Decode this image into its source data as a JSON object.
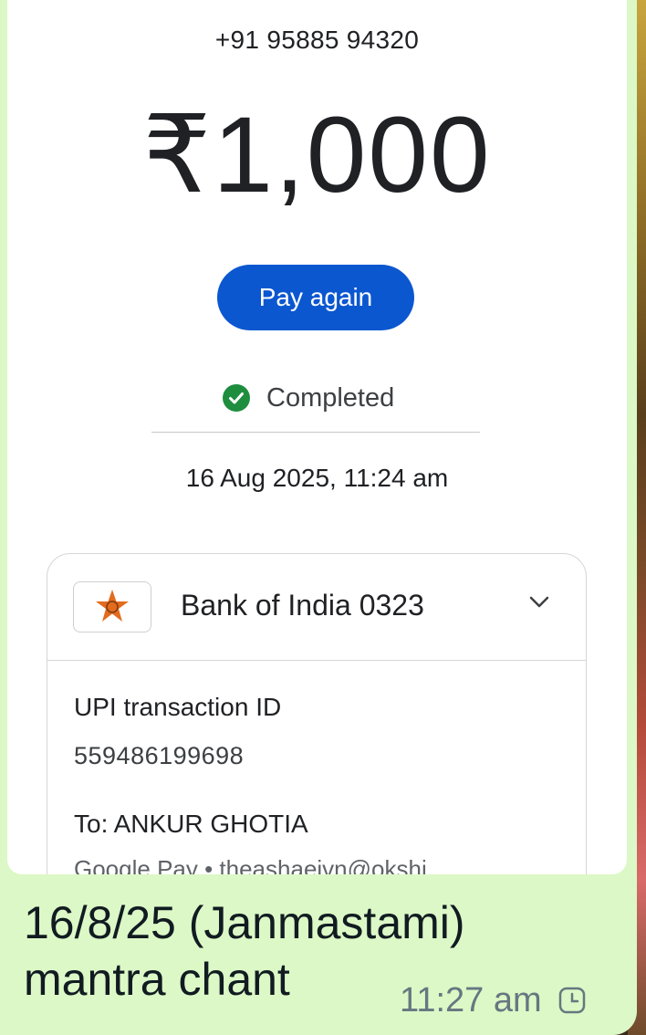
{
  "receipt": {
    "phone": "+91 95885 94320",
    "amount": "₹1,000",
    "pay_again_label": "Pay again",
    "status": "Completed",
    "datetime": "16 Aug 2025, 11:24 am",
    "bank": {
      "name": "Bank of India 0323",
      "logo_icon": "bank-of-india-star-icon"
    },
    "upi_label": "UPI transaction ID",
    "upi_id": "559486199698",
    "to_label": "To: ANKUR GHOTIA",
    "gpay_line": "Google Pay • theashaeivn@okshi"
  },
  "message": {
    "caption": "16/8/25 (Janmastami) mantra chant",
    "time": "11:27 am",
    "status_icon": "pending-clock-icon"
  },
  "colors": {
    "bubble": "#dcf8c6",
    "accent_button": "#0b57d0",
    "success": "#1e8e3e",
    "bank_logo": "#e36b1e"
  }
}
